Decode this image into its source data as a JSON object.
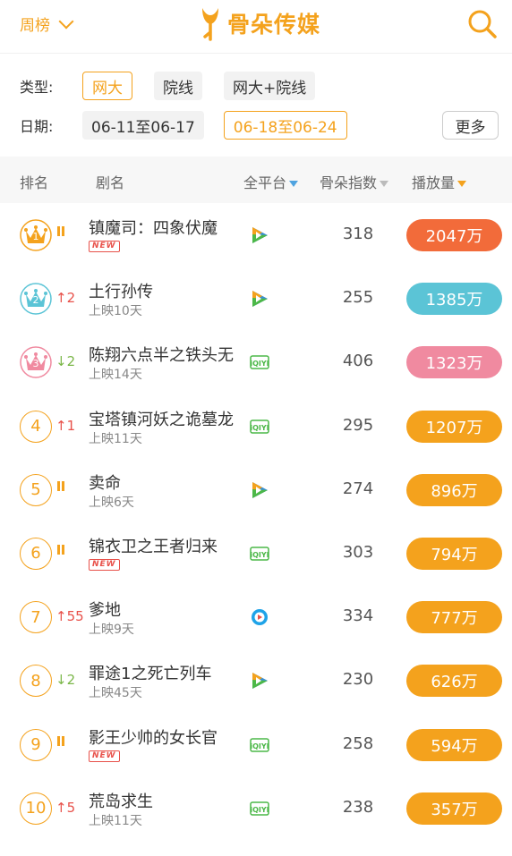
{
  "header": {
    "period_label": "周榜",
    "brand": "骨朵传媒"
  },
  "filters": {
    "type_label": "类型:",
    "type_options": [
      "网大",
      "院线",
      "网大+院线"
    ],
    "date_label": "日期:",
    "date_options": [
      "06-11至06-17",
      "06-18至06-24"
    ],
    "more_label": "更多"
  },
  "columns": {
    "rank": "排名",
    "title": "剧名",
    "platform": "全平台",
    "index": "骨朵指数",
    "plays": "播放量"
  },
  "colors": {
    "accent": "#f4a21d",
    "rank1": "#f26b3a",
    "rank2": "#5bc4d6",
    "rank3": "#f08aa0",
    "up": "#e8514a",
    "down": "#7ab648"
  },
  "rows": [
    {
      "rank": "1",
      "change": "",
      "change_dir": "same",
      "title": "镇魔司：四象伏魔",
      "sub": "",
      "is_new": true,
      "new_label": "NEW",
      "platform": "tencent-video-icon",
      "index": "318",
      "plays": "2047万",
      "pill_color": "#f26b3a",
      "crown": "#f4a21d"
    },
    {
      "rank": "2",
      "change": "2",
      "change_dir": "up",
      "title": "土行孙传",
      "sub": "上映10天",
      "is_new": false,
      "new_label": "",
      "platform": "tencent-video-icon",
      "index": "255",
      "plays": "1385万",
      "pill_color": "#5bc4d6",
      "crown": "#5bc4d6"
    },
    {
      "rank": "3",
      "change": "2",
      "change_dir": "down",
      "title": "陈翔六点半之铁头无",
      "sub": "上映14天",
      "is_new": false,
      "new_label": "",
      "platform": "iqiyi-icon",
      "index": "406",
      "plays": "1323万",
      "pill_color": "#f08aa0",
      "crown": "#f08aa0"
    },
    {
      "rank": "4",
      "change": "1",
      "change_dir": "up",
      "title": "宝塔镇河妖之诡墓龙",
      "sub": "上映11天",
      "is_new": false,
      "new_label": "",
      "platform": "iqiyi-icon",
      "index": "295",
      "plays": "1207万",
      "pill_color": "#f4a21d",
      "crown": ""
    },
    {
      "rank": "5",
      "change": "",
      "change_dir": "same",
      "title": "卖命",
      "sub": "上映6天",
      "is_new": false,
      "new_label": "",
      "platform": "tencent-video-icon",
      "index": "274",
      "plays": "896万",
      "pill_color": "#f4a21d",
      "crown": ""
    },
    {
      "rank": "6",
      "change": "",
      "change_dir": "same",
      "title": "锦衣卫之王者归来",
      "sub": "",
      "is_new": true,
      "new_label": "NEW",
      "platform": "iqiyi-icon",
      "index": "303",
      "plays": "794万",
      "pill_color": "#f4a21d",
      "crown": ""
    },
    {
      "rank": "7",
      "change": "55",
      "change_dir": "up",
      "title": "爹地",
      "sub": "上映9天",
      "is_new": false,
      "new_label": "",
      "platform": "youku-icon",
      "index": "334",
      "plays": "777万",
      "pill_color": "#f4a21d",
      "crown": ""
    },
    {
      "rank": "8",
      "change": "2",
      "change_dir": "down",
      "title": "罪途1之死亡列车",
      "sub": "上映45天",
      "is_new": false,
      "new_label": "",
      "platform": "tencent-video-icon",
      "index": "230",
      "plays": "626万",
      "pill_color": "#f4a21d",
      "crown": ""
    },
    {
      "rank": "9",
      "change": "",
      "change_dir": "same",
      "title": "影王少帅的女长官",
      "sub": "",
      "is_new": true,
      "new_label": "NEW",
      "platform": "iqiyi-icon",
      "index": "258",
      "plays": "594万",
      "pill_color": "#f4a21d",
      "crown": ""
    },
    {
      "rank": "10",
      "change": "5",
      "change_dir": "up",
      "title": "荒岛求生",
      "sub": "上映11天",
      "is_new": false,
      "new_label": "",
      "platform": "iqiyi-icon",
      "index": "238",
      "plays": "357万",
      "pill_color": "#f4a21d",
      "crown": ""
    }
  ]
}
